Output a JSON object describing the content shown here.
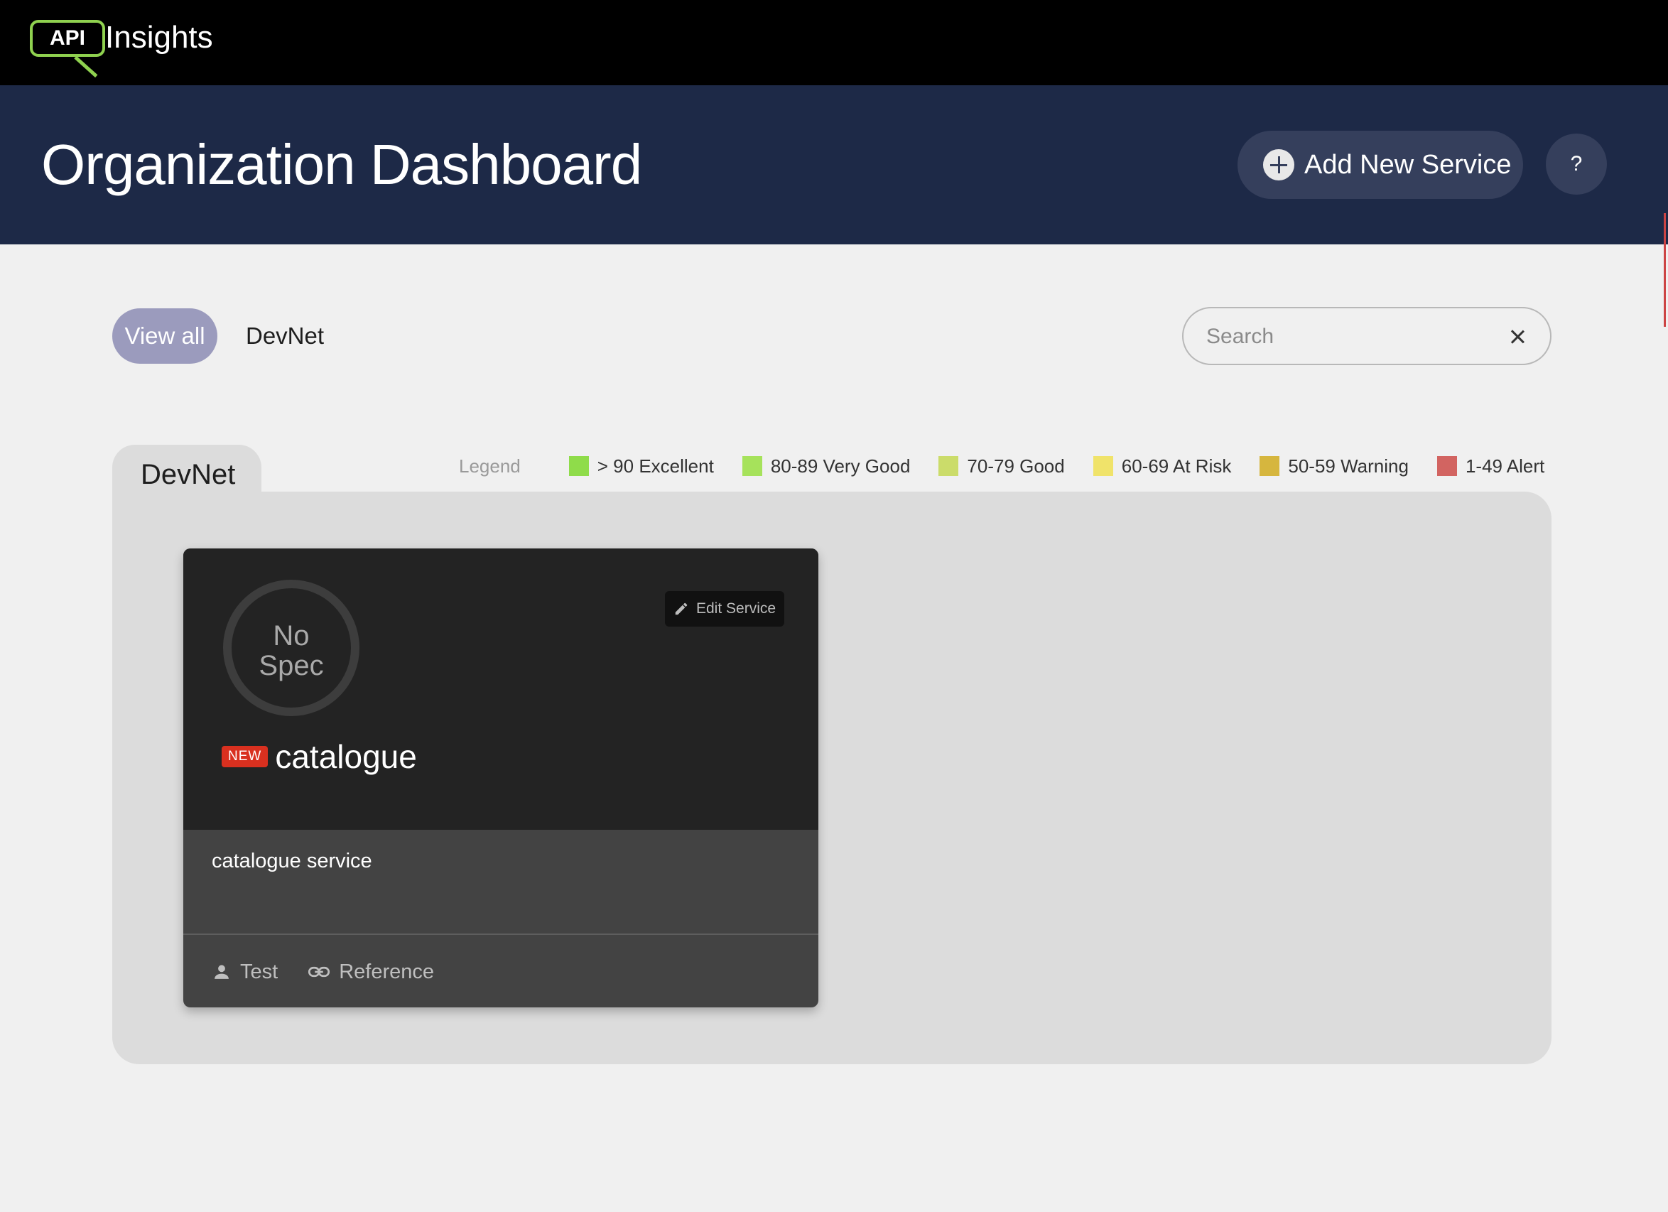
{
  "app": {
    "logo_badge": "API",
    "logo_name": "Insights"
  },
  "header": {
    "title": "Organization Dashboard",
    "add_button": "Add New Service",
    "help_button": "?"
  },
  "filters": {
    "view_all": "View all",
    "devnet": "DevNet"
  },
  "search": {
    "placeholder": "Search",
    "value": ""
  },
  "group": {
    "name": "DevNet"
  },
  "legend": {
    "title": "Legend",
    "items": [
      {
        "label": "> 90 Excellent",
        "color": "#8fdc4a"
      },
      {
        "label": "80-89 Very Good",
        "color": "#a6e25b"
      },
      {
        "label": "70-79 Good",
        "color": "#cbdc6a"
      },
      {
        "label": "60-69 At Risk",
        "color": "#f0e36a"
      },
      {
        "label": "50-59 Warning",
        "color": "#d6b63e"
      },
      {
        "label": "1-49 Alert",
        "color": "#d26461"
      }
    ]
  },
  "card": {
    "score_line1": "No",
    "score_line2": "Spec",
    "edit_label": "Edit Service",
    "badge": "NEW",
    "name": "catalogue",
    "description": "catalogue service",
    "owner": "Test",
    "reference": "Reference"
  },
  "colors": {
    "topbar": "#000000",
    "header": "#1d2947",
    "accent": "#8fd14f",
    "badge_new": "#d9301f"
  }
}
